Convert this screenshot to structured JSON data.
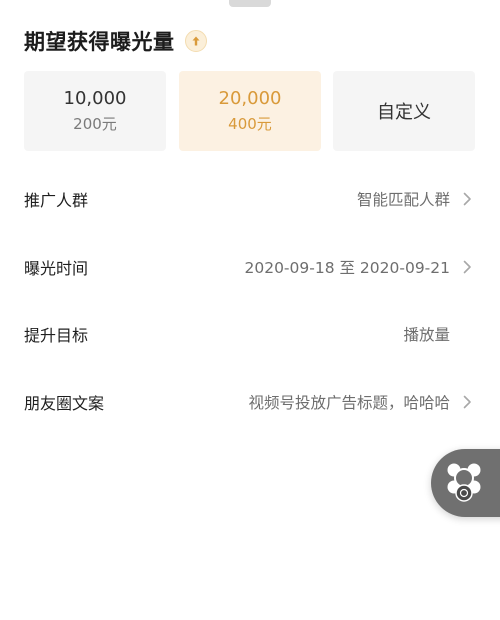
{
  "header": {
    "title": "期望获得曝光量"
  },
  "options": [
    {
      "amount": "10,000",
      "price": "200元",
      "selected": false
    },
    {
      "amount": "20,000",
      "price": "400元",
      "selected": true
    },
    {
      "label": "自定义",
      "selected": false
    }
  ],
  "settings": [
    {
      "label": "推广人群",
      "value": "智能匹配人群",
      "has_arrow": true
    },
    {
      "label": "曝光时间",
      "value": "2020-09-18 至 2020-09-21",
      "has_arrow": true
    },
    {
      "label": "提升目标",
      "value": "播放量",
      "has_arrow": false
    },
    {
      "label": "朋友圈文案",
      "value": "视频号投放广告标题，哈哈哈",
      "has_arrow": true
    }
  ],
  "colors": {
    "accent": "#d99a3a",
    "selected_bg": "#fcf1e2",
    "option_bg": "#f5f5f5"
  },
  "icons": {
    "title_icon": "arrow-up-circle-icon",
    "floating_icon": "floating-window-icon",
    "row_arrow": "chevron-right-icon"
  }
}
